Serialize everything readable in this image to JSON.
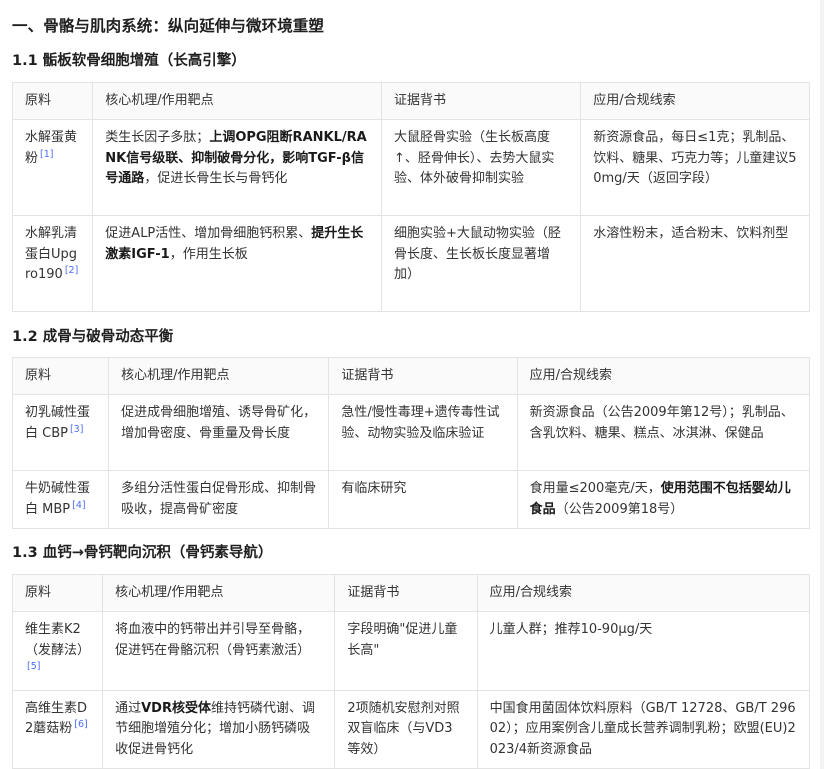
{
  "doc": {
    "section_title": "一、骨骼与肌肉系统：纵向延伸与微环境重塑",
    "headers": [
      "原料",
      "核心机理/作用靶点",
      "证据背书",
      "应用/合规线索"
    ],
    "subsections": [
      {
        "title": "1.1 骺板软骨细胞增殖（长高引擎）",
        "rows": [
          {
            "material": "水解蛋黄粉",
            "ref": "[1]",
            "mechanism": [
              {
                "t": "类生长因子多肽；",
                "b": false
              },
              {
                "t": "上调OPG阻断RANKL/RANK信号级联、抑制破骨分化，影响TGF-β信号通路",
                "b": true
              },
              {
                "t": "，促进长骨生长与骨钙化",
                "b": false
              }
            ],
            "evidence": "大鼠胫骨实验（生长板高度↑、胫骨伸长）、去势大鼠实验、体外破骨抑制实验",
            "application": [
              {
                "t": "新资源食品，每日≤1克；乳制品、饮料、糖果、巧克力等；儿童建议50mg/天（返回字段）",
                "b": false
              }
            ]
          },
          {
            "material": "水解乳清蛋白Upgro190",
            "ref": "[2]",
            "mechanism": [
              {
                "t": "促进ALP活性、增加骨细胞钙积累、",
                "b": false
              },
              {
                "t": "提升生长激素IGF-1",
                "b": true
              },
              {
                "t": "，作用生长板",
                "b": false
              }
            ],
            "evidence": "细胞实验+大鼠动物实验（胫骨长度、生长板长度显著增加）",
            "application": [
              {
                "t": "水溶性粉末，适合粉末、饮料剂型",
                "b": false
              }
            ]
          }
        ]
      },
      {
        "title": "1.2 成骨与破骨动态平衡",
        "rows": [
          {
            "material": "初乳碱性蛋白 CBP",
            "ref": "[3]",
            "mechanism": [
              {
                "t": "促进成骨细胞增殖、诱导骨矿化，增加骨密度、骨重量及骨长度",
                "b": false
              }
            ],
            "evidence": "急性/慢性毒理+遗传毒性试验、动物实验及临床验证",
            "application": [
              {
                "t": "新资源食品（公告2009年第12号）；乳制品、含乳饮料、糖果、糕点、冰淇淋、保健品",
                "b": false
              }
            ]
          },
          {
            "material": "牛奶碱性蛋白 MBP",
            "ref": "[4]",
            "mechanism": [
              {
                "t": "多组分活性蛋白促骨形成、抑制骨吸收，提高骨矿密度",
                "b": false
              }
            ],
            "evidence": "有临床研究",
            "application": [
              {
                "t": "食用量≤200毫克/天，",
                "b": false
              },
              {
                "t": "使用范围不包括婴幼儿食品",
                "b": true
              },
              {
                "t": "（公告2009第18号）",
                "b": false
              }
            ]
          }
        ]
      },
      {
        "title": "1.3 血钙→骨钙靶向沉积（骨钙素导航）",
        "rows": [
          {
            "material": "维生素K2（发酵法）",
            "ref": "[5]",
            "mechanism": [
              {
                "t": "将血液中的钙带出并引导至骨骼，促进钙在骨骼沉积（骨钙素激活）",
                "b": false
              }
            ],
            "evidence": "字段明确\"促进儿童长高\"",
            "application": [
              {
                "t": "儿童人群；推荐10-90μg/天",
                "b": false
              }
            ]
          },
          {
            "material": "高维生素D2蘑菇粉",
            "ref": "[6]",
            "mechanism": [
              {
                "t": "通过",
                "b": false
              },
              {
                "t": "VDR核受体",
                "b": true
              },
              {
                "t": "维持钙磷代谢、调节细胞增殖分化；增加小肠钙磷吸收促进骨钙化",
                "b": false
              }
            ],
            "evidence": "2项随机安慰剂对照双盲临床（与VD3等效）",
            "application": [
              {
                "t": "中国食用菌固体饮料原料（GB/T 12728、GB/T 29602）；应用案例含儿童成长营养调制乳粉；欧盟(EU)2023/4新资源食品",
                "b": false
              }
            ]
          }
        ]
      }
    ]
  }
}
